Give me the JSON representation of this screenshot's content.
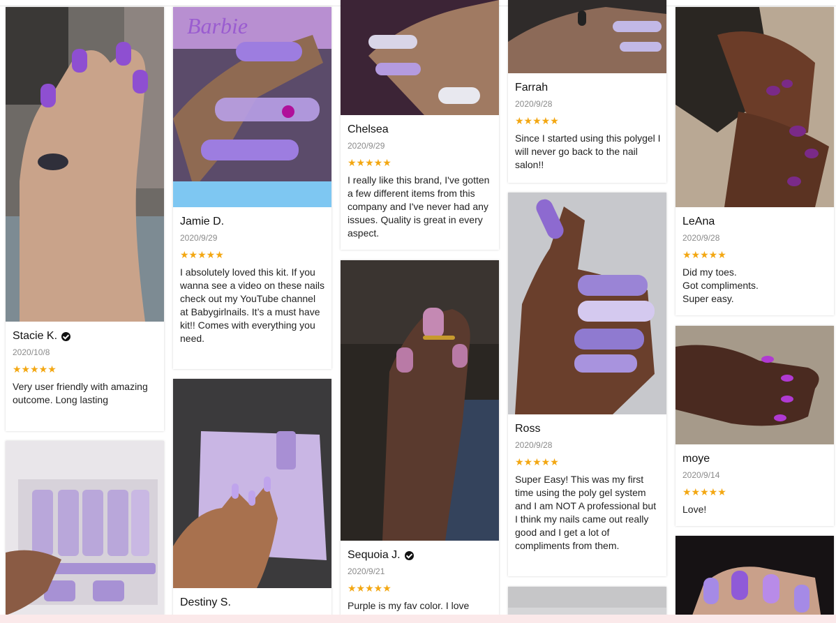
{
  "reviews": [
    {
      "name": "Stacie K.",
      "date": "2020/10/8",
      "stars": "★★★★★",
      "verified": true,
      "text": "Very user friendly with amazing outcome. Long lasting",
      "photo": "purple-nails-hand"
    },
    {
      "name": "Jamie D.",
      "date": "2020/9/29",
      "stars": "★★★★★",
      "verified": false,
      "text": "I absolutely loved this kit. If you wanna see a video on these nails check out my YouTube channel at Babygirlnails. It’s a must have kit!! Comes with everything you need.",
      "photo": "barbie-long-nails"
    },
    {
      "name": "Chelsea",
      "date": "2020/9/29",
      "stars": "★★★★★",
      "verified": false,
      "text": "I really like this brand, I've gotten a few different items from this company and I've never had any issues. Quality is great in every aspect.",
      "photo": "glitter-nails"
    },
    {
      "name": "Farrah",
      "date": "2020/9/28",
      "stars": "★★★★★",
      "verified": false,
      "text": "Since I started using this polygel I will never go back to the nail salon!!",
      "photo": "lavender-stiletto-nails"
    },
    {
      "name": "LeAna",
      "date": "2020/9/28",
      "stars": "★★★★★",
      "verified": false,
      "text": "Did my toes.\nGot compliments.\nSuper easy.",
      "photo": "purple-toes"
    },
    {
      "name": "Ross",
      "date": "2020/9/28",
      "stars": "★★★★★",
      "verified": false,
      "text": " Super Easy! This was my first time using the poly gel system and I am NOT A professional but I think my nails came out really good and I get a lot of compliments from them.",
      "photo": "glitter-coffin-nails"
    },
    {
      "name": "moye",
      "date": "2020/9/14",
      "stars": "★★★★★",
      "verified": false,
      "text": "Love!",
      "photo": "purple-hand-carpet"
    },
    {
      "name": "Sequoia J.",
      "date": "2020/9/21",
      "stars": "★★★★★",
      "verified": true,
      "text": "Purple is my fav color. I love",
      "photo": "pink-nails-ring"
    },
    {
      "name": "Destiny S.",
      "date": "",
      "stars": "",
      "verified": false,
      "text": "",
      "photo": "nail-kit-box"
    }
  ],
  "colors": {
    "star": "#f3a712",
    "accent_band": "#fbe9ea"
  }
}
